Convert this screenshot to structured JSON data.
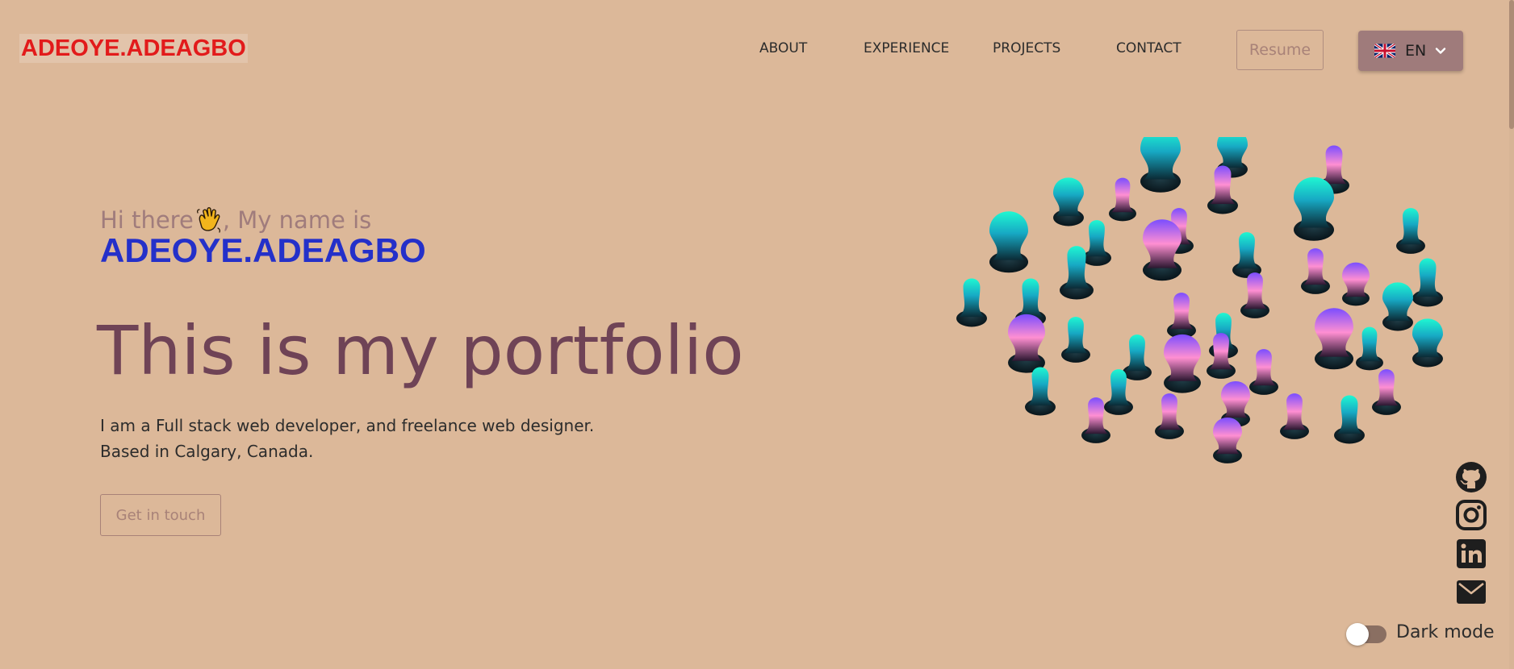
{
  "header": {
    "logo": "ADEOYE.ADEAGBO",
    "nav": [
      {
        "id": "about",
        "label": "ABOUT"
      },
      {
        "id": "experience",
        "label": "EXPERIENCE"
      },
      {
        "id": "projects",
        "label": "PROJECTS"
      },
      {
        "id": "contact",
        "label": "CONTACT"
      }
    ],
    "resume_label": "Resume",
    "language": {
      "code": "EN",
      "flag_icon": "uk-flag-icon"
    }
  },
  "hero": {
    "greeting_before": "Hi there",
    "greeting_after": ", My name is",
    "name": "ADEOYE.ADEAGBO",
    "headline": "This is my portfolio",
    "description_line1": "I am a Full stack web developer, and freelance web designer.",
    "description_line2": "Based in Calgary, Canada.",
    "cta_label": "Get in touch"
  },
  "social": [
    {
      "id": "github",
      "icon": "github-icon"
    },
    {
      "id": "instagram",
      "icon": "instagram-icon"
    },
    {
      "id": "linkedin",
      "icon": "linkedin-icon"
    },
    {
      "id": "email",
      "icon": "email-icon"
    }
  ],
  "theme": {
    "dark_mode_label": "Dark mode",
    "dark_mode_on": false
  },
  "colors": {
    "background": "#dcb899",
    "logo": "#e21b1b",
    "name": "#2430c9",
    "headline": "#6f4356",
    "accent_cyan": "#1df2d0",
    "accent_purple": "#7a4dff",
    "accent_pink": "#ff8fd2"
  }
}
